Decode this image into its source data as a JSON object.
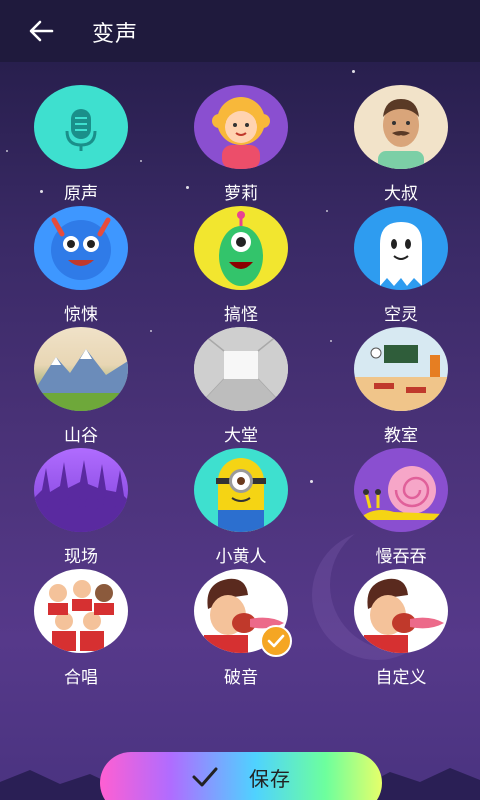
{
  "header": {
    "title": "变声",
    "back_icon": "arrow-left-icon"
  },
  "effects": [
    {
      "label": "原声",
      "icon": "microphone-icon",
      "selected": false
    },
    {
      "label": "萝莉",
      "icon": "girl-avatar-icon",
      "selected": false
    },
    {
      "label": "大叔",
      "icon": "uncle-avatar-icon",
      "selected": false
    },
    {
      "label": "惊悚",
      "icon": "blue-monster-icon",
      "selected": false
    },
    {
      "label": "搞怪",
      "icon": "green-monster-icon",
      "selected": false
    },
    {
      "label": "空灵",
      "icon": "ghost-icon",
      "selected": false
    },
    {
      "label": "山谷",
      "icon": "mountain-valley-icon",
      "selected": false
    },
    {
      "label": "大堂",
      "icon": "hall-icon",
      "selected": false
    },
    {
      "label": "教室",
      "icon": "classroom-icon",
      "selected": false
    },
    {
      "label": "现场",
      "icon": "concert-crowd-icon",
      "selected": false
    },
    {
      "label": "小黄人",
      "icon": "minion-icon",
      "selected": false
    },
    {
      "label": "慢吞吞",
      "icon": "snail-icon",
      "selected": false
    },
    {
      "label": "合唱",
      "icon": "choir-icon",
      "selected": false
    },
    {
      "label": "破音",
      "icon": "shouting-man-icon",
      "selected": true
    },
    {
      "label": "自定义",
      "icon": "shouting-man-custom-icon",
      "selected": false
    }
  ],
  "save_button": {
    "label": "保存",
    "icon": "checkmark-icon"
  },
  "colors": {
    "header_bg": "#1f1a3d",
    "selected_badge": "#f5a623"
  }
}
